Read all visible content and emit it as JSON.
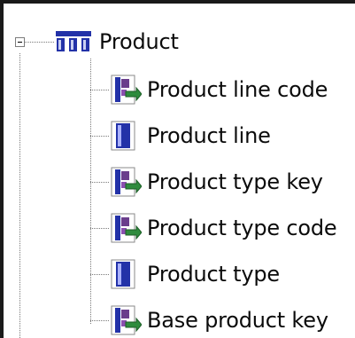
{
  "tree": {
    "root": {
      "label": "Product",
      "icon": "dimension-table-icon",
      "expanded": true
    },
    "items": [
      {
        "label": "Product line code",
        "icon": "key-member-icon"
      },
      {
        "label": "Product line",
        "icon": "level-member-icon"
      },
      {
        "label": "Product type key",
        "icon": "key-member-icon"
      },
      {
        "label": "Product type code",
        "icon": "key-member-icon"
      },
      {
        "label": "Product type",
        "icon": "level-member-icon"
      },
      {
        "label": "Base product key",
        "icon": "key-member-icon"
      }
    ]
  },
  "colors": {
    "icon_blue": "#2332a8",
    "icon_purple": "#6a3d8c",
    "arrow_green": "#2e8b3d"
  }
}
